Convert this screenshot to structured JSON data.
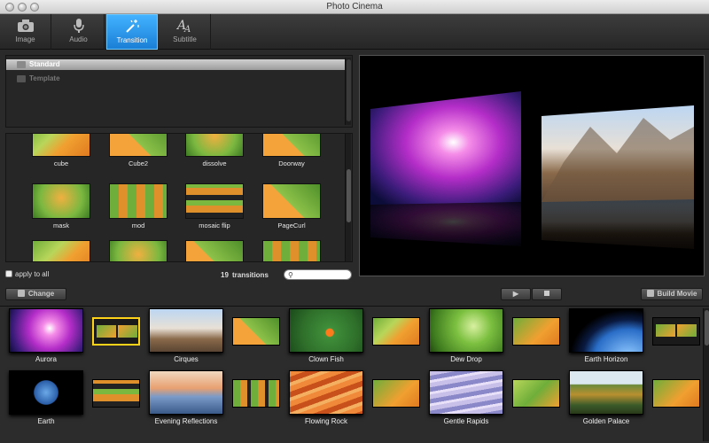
{
  "window": {
    "title": "Photo Cinema"
  },
  "toolbar": {
    "tabs": [
      {
        "label": "Image",
        "icon": "camera-icon"
      },
      {
        "label": "Audio",
        "icon": "microphone-icon"
      },
      {
        "label": "Transition",
        "icon": "sparkle-wand-icon",
        "active": true
      },
      {
        "label": "Subtitle",
        "icon": "text-aa-icon"
      }
    ]
  },
  "categories": [
    {
      "label": "Standard",
      "selected": true
    },
    {
      "label": "Template",
      "selected": false
    }
  ],
  "transitions": {
    "items": [
      {
        "label": "cube"
      },
      {
        "label": "Cube2"
      },
      {
        "label": "dissolve"
      },
      {
        "label": "Doorway"
      },
      {
        "label": "mask"
      },
      {
        "label": "mod"
      },
      {
        "label": "mosaic flip"
      },
      {
        "label": "PageCurl"
      },
      {
        "label": ""
      },
      {
        "label": ""
      },
      {
        "label": ""
      },
      {
        "label": ""
      }
    ],
    "apply_to_all_label": "apply to all",
    "count": "19",
    "count_label": "transitions",
    "search_placeholder": ""
  },
  "actions": {
    "change_label": "Change",
    "build_label": "Build Movie"
  },
  "filmstrip": {
    "row1": [
      "Aurora",
      "Cirques",
      "Clown Fish",
      "Dew Drop",
      "Earth Horizon"
    ],
    "row2": [
      "Earth",
      "Evening Reflections",
      "Flowing Rock",
      "Gentle Rapids",
      "Golden Palace"
    ]
  },
  "colors": {
    "accent": "#2a93ec",
    "selection_outline": "#ffd21a"
  }
}
